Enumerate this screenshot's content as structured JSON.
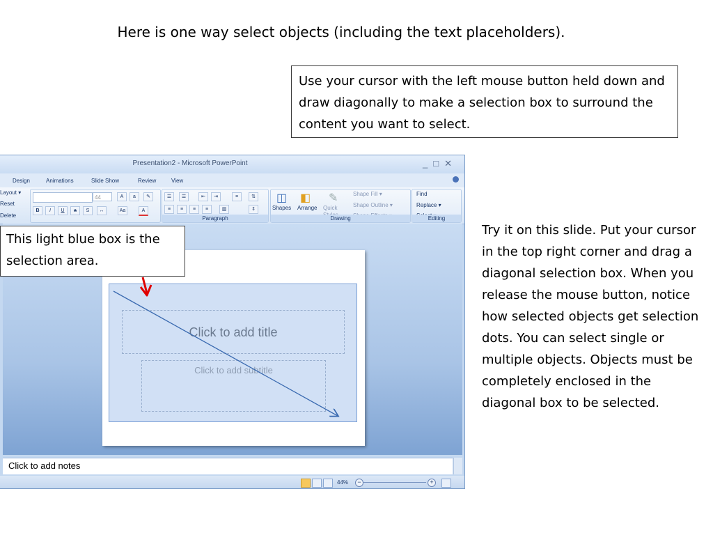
{
  "slide": {
    "heading": "Here is one way select objects (including the text placeholders).",
    "callout_top": "Use your cursor with the left mouse button held down and draw diagonally to make a selection box to surround the content you want to select.",
    "callout_left": "This light blue box is the selection area.",
    "instructions": "Try it on this slide. Put your cursor in the top right corner and drag a diagonal selection box. When you release the mouse button, notice how selected objects get selection dots. You can select single or multiple objects.   Objects must be completely enclosed in the diagonal box to be selected."
  },
  "window": {
    "title": "Presentation2 - Microsoft PowerPoint",
    "tabs": [
      "Design",
      "Animations",
      "Slide Show",
      "Review",
      "View"
    ]
  },
  "ribbon": {
    "slides_group": [
      "Layout ▾",
      "Reset",
      "Delete"
    ],
    "font_size": "44",
    "paragraph_label": "Paragraph",
    "drawing_label": "Drawing",
    "editing_label": "Editing",
    "shapes": "Shapes",
    "arrange": "Arrange",
    "quick_styles": "Quick Styles",
    "shape_fill": "Shape Fill ▾",
    "shape_outline": "Shape Outline ▾",
    "shape_effects": "Shape Effects ▾",
    "find": "Find",
    "replace": "Replace ▾",
    "select": "Select ▾"
  },
  "slide_canvas": {
    "title_placeholder": "Click to add title",
    "subtitle_placeholder": "Click to add subtitle"
  },
  "notes": {
    "placeholder": "Click to add notes"
  },
  "status": {
    "zoom": "44%"
  },
  "colors": {
    "selection_fill": "#99bae8",
    "arrow_red": "#e00000",
    "arrow_blue": "#3a6ab0"
  }
}
